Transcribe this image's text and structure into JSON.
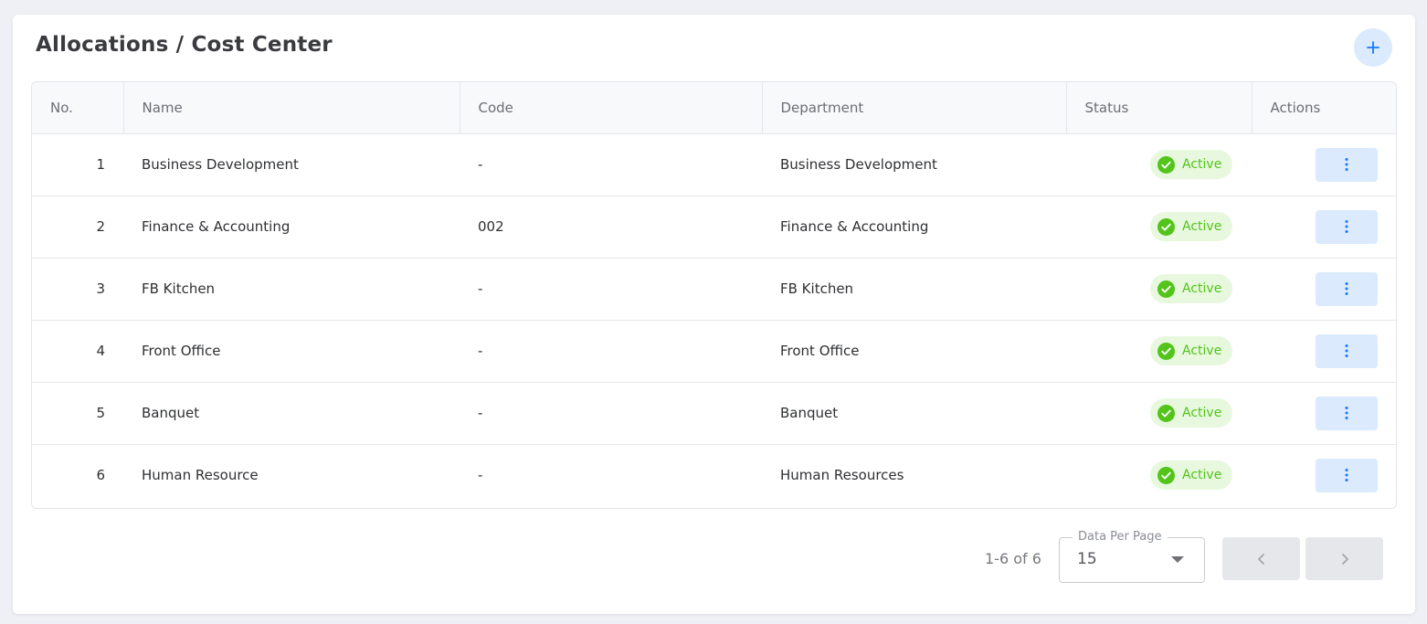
{
  "page": {
    "title": "Allocations / Cost Center"
  },
  "icons": {
    "add": "plus-icon",
    "status": "check-circle-icon",
    "actions": "more-vertical-icon",
    "prev": "chevron-left-icon",
    "next": "chevron-right-icon",
    "dropdown": "caret-down-icon"
  },
  "colors": {
    "accent": "#1677ff",
    "accent_bg": "#dbeafc",
    "status_green": "#52c41a",
    "status_bg": "#e8f8df"
  },
  "table": {
    "columns": [
      "No.",
      "Name",
      "Code",
      "Department",
      "Status",
      "Actions"
    ],
    "rows": [
      {
        "no": "1",
        "name": "Business Development",
        "code": "-",
        "department": "Business Development",
        "status": "Active"
      },
      {
        "no": "2",
        "name": "Finance & Accounting",
        "code": "002",
        "department": "Finance & Accounting",
        "status": "Active"
      },
      {
        "no": "3",
        "name": "FB Kitchen",
        "code": "-",
        "department": "FB Kitchen",
        "status": "Active"
      },
      {
        "no": "4",
        "name": "Front Office",
        "code": "-",
        "department": "Front Office",
        "status": "Active"
      },
      {
        "no": "5",
        "name": "Banquet",
        "code": "-",
        "department": "Banquet",
        "status": "Active"
      },
      {
        "no": "6",
        "name": "Human Resource",
        "code": "-",
        "department": "Human Resources",
        "status": "Active"
      }
    ]
  },
  "pagination": {
    "range": "1-6 of 6",
    "per_page_label": "Data Per Page",
    "per_page_value": "15"
  }
}
